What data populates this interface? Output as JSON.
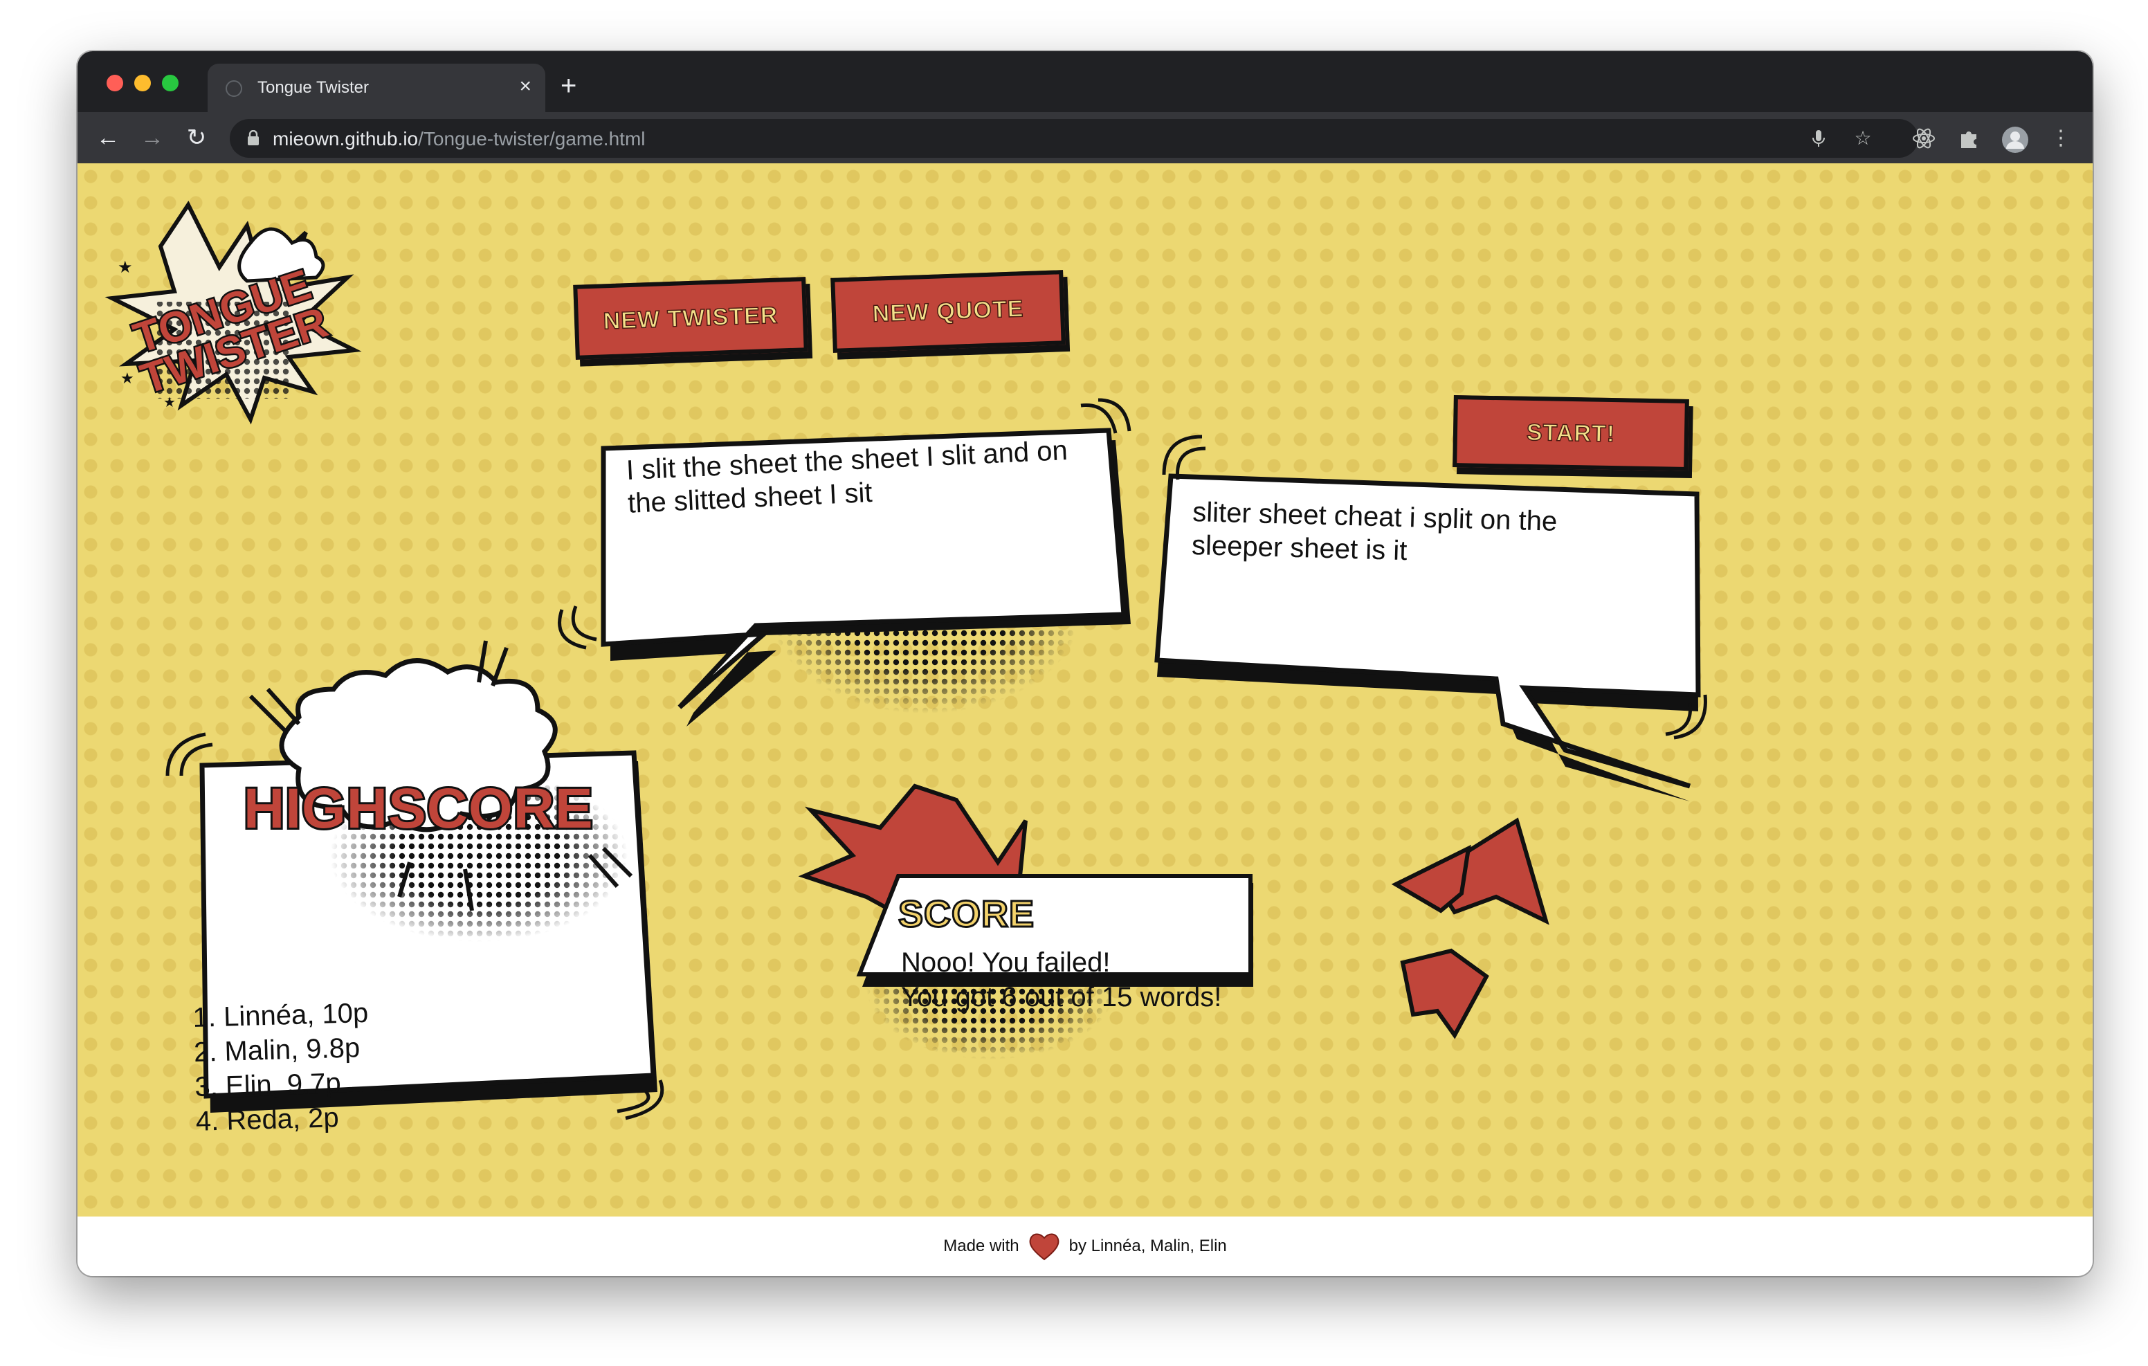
{
  "browser": {
    "tab_title": "Tongue Twister",
    "url_host": "mieown.github.io",
    "url_path": "/Tongue-twister/game.html"
  },
  "logo": {
    "line1": "TONGUE",
    "line2": "TWISTER"
  },
  "buttons": {
    "new_twister": "NEW TWISTER",
    "new_quote": "NEW QUOTE",
    "start": "START!"
  },
  "twister_text": [
    "I slit the sheet the sheet I slit and on",
    "the slitted sheet I sit"
  ],
  "spoken_text": [
    "sliter sheet cheat i split on the",
    "sleeper sheet is it"
  ],
  "highscore": {
    "title": "HIGHSCORE",
    "entries": [
      "1. Linnéa, 10p",
      "2. Malin, 9.8p",
      "3. Elin, 9.7p",
      "4. Reda, 2p"
    ]
  },
  "score": {
    "label": "SCORE",
    "line1": "Nooo! You failed!",
    "line2": "You got 6 out of 15 words!"
  },
  "footer": {
    "made_with": "Made with",
    "credits": "by Linnéa, Malin, Elin"
  },
  "colors": {
    "background": "#ecd872",
    "accent": "#c0453a",
    "button_text": "#f3e08a",
    "ink": "#111111"
  }
}
